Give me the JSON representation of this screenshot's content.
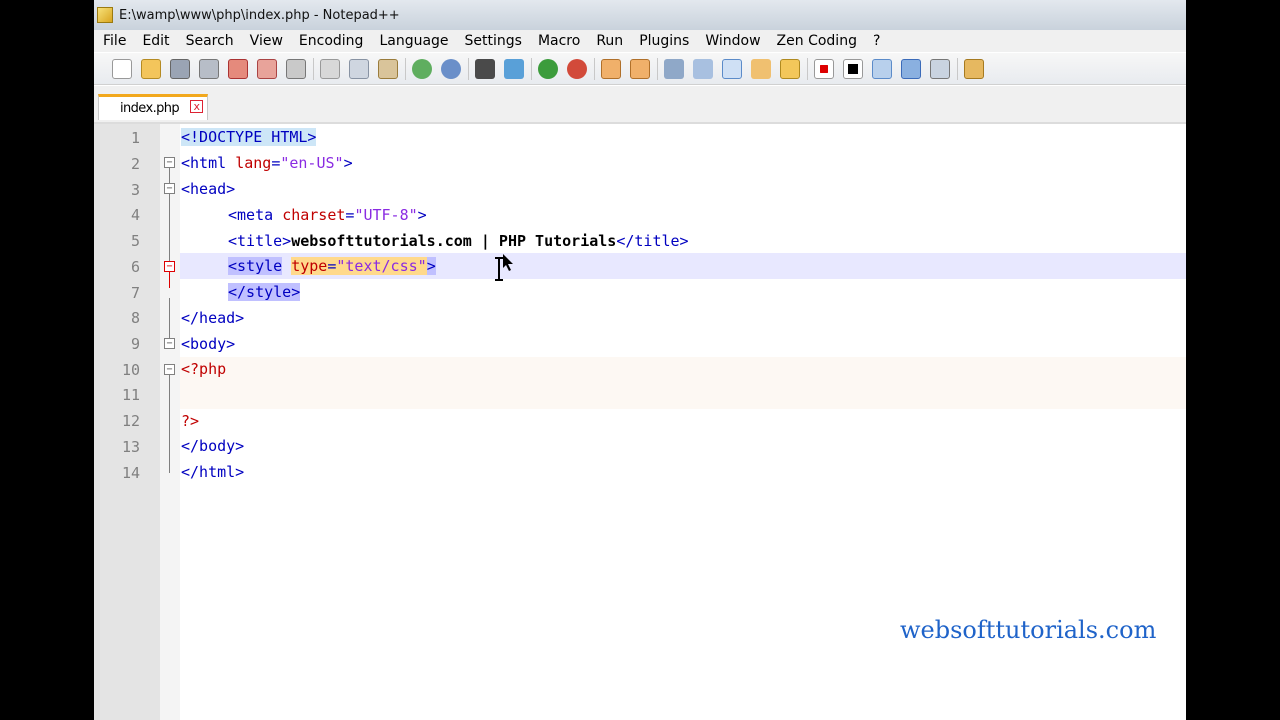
{
  "window": {
    "title": "E:\\wamp\\www\\php\\index.php - Notepad++"
  },
  "menu": [
    "File",
    "Edit",
    "Search",
    "View",
    "Encoding",
    "Language",
    "Settings",
    "Macro",
    "Run",
    "Plugins",
    "Window",
    "Zen Coding",
    "?"
  ],
  "tab": {
    "label": "index.php",
    "close": "x"
  },
  "lines": {
    "n1": "1",
    "n2": "2",
    "n3": "3",
    "n4": "4",
    "n5": "5",
    "n6": "6",
    "n7": "7",
    "n8": "8",
    "n9": "9",
    "n10": "10",
    "n11": "11",
    "n12": "12",
    "n13": "13",
    "n14": "14"
  },
  "code": {
    "l1": "<!DOCTYPE HTML>",
    "l2_open": "<html ",
    "l2_attr": "lang",
    "l2_eq": "=",
    "l2_val": "\"en-US\"",
    "l2_close": ">",
    "l3": "<head>",
    "l4_open": "<meta ",
    "l4_attr": "charset",
    "l4_eq": "=",
    "l4_val": "\"UTF-8\"",
    "l4_close": ">",
    "l5_open": "<title>",
    "l5_text": "websofttutorials.com | PHP Tutorials",
    "l5_close": "</title>",
    "l6_open": "<style",
    "l6_attr": "type",
    "l6_eq": "=",
    "l6_val": "\"text/css\"",
    "l6_close": ">",
    "l7": "</style>",
    "l8": "</head>",
    "l9": "<body>",
    "l10": "<?php",
    "l12": "?>",
    "l13": "</body>",
    "l14": "</html>"
  },
  "watermark": "websofttutorials.com"
}
